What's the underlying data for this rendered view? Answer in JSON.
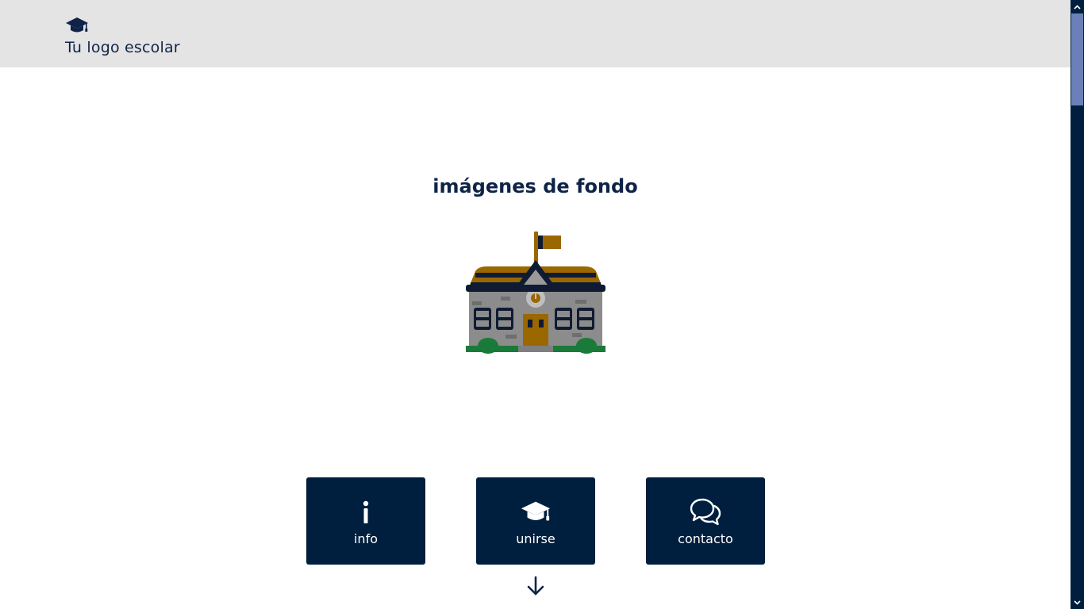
{
  "header": {
    "logo_icon": "graduation-cap-icon",
    "logo_text": "Tu logo escolar",
    "background": "#e4e4e4"
  },
  "hero": {
    "title": "imágenes de fondo",
    "illustration": "school-building-icon"
  },
  "tiles": [
    {
      "label": "info",
      "icon": "info-icon"
    },
    {
      "label": "unirse",
      "icon": "graduation-cap-icon"
    },
    {
      "label": "contacto",
      "icon": "chat-bubbles-icon"
    }
  ],
  "scroll_indicator": {
    "icon": "arrow-down-icon"
  },
  "colors": {
    "navy": "#001f3f",
    "text": "#0f2347",
    "gold": "#9a6700",
    "scroll_thumb": "#6b7fb8"
  }
}
